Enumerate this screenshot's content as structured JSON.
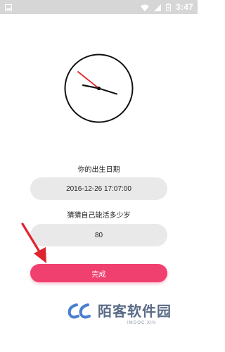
{
  "status_bar": {
    "time": "3:47",
    "left_icon": "image-icon",
    "right_icons": [
      "wifi-icon",
      "signal-icon",
      "battery-icon"
    ],
    "background": "#d6d6d6"
  },
  "clock": {
    "hour_hand_color": "#111111",
    "minute_hand_color": "#111111",
    "second_hand_color": "#e0242f"
  },
  "form": {
    "birth_label": "你的出生日期",
    "birth_value": "2016-12-26 17:07:00",
    "guess_label": "猜猜自己能活多少岁",
    "age_value": "80"
  },
  "actions": {
    "done_label": "完成",
    "accent": "#f0406f"
  },
  "annotation": {
    "arrow_color": "#e0242f"
  },
  "watermark": {
    "title": "陌客软件园",
    "subtitle": "IMOOC.XIN"
  }
}
